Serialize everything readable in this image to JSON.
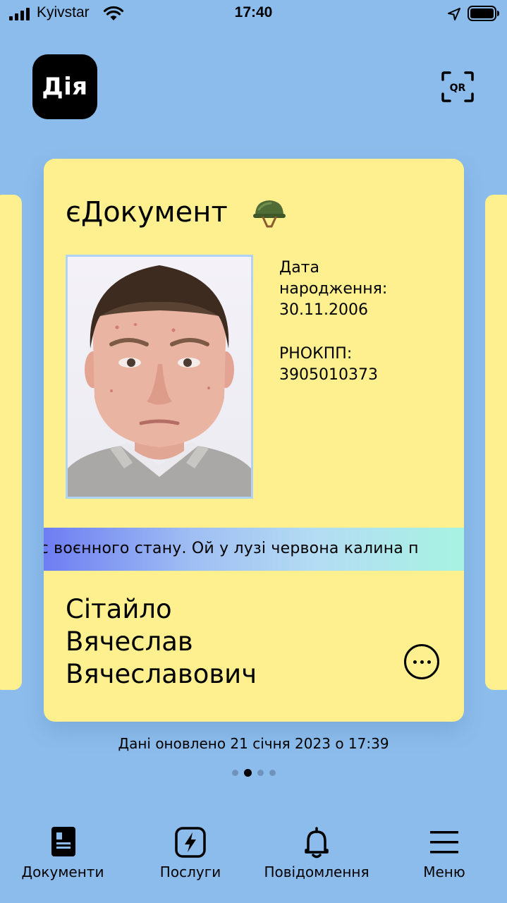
{
  "status_bar": {
    "carrier": "Kyivstar",
    "time": "17:40"
  },
  "header": {
    "logo_text": "Дія",
    "qr_label": "QR"
  },
  "card": {
    "title": "єДокумент",
    "title_icon": "military-helmet-icon",
    "birth_label_line1": "Дата",
    "birth_label_line2": "народження:",
    "birth_date": "30.11.2006",
    "tax_label": "РНОКПП:",
    "tax_number": "3905010373",
    "ticker": "ас воєнного стану. Ой у лузі червона калина п",
    "name": [
      "Сітайло",
      "Вячеслав",
      "Вячеславович"
    ]
  },
  "updated_text": "Дані оновлено 21 січня 2023 о 17:39",
  "pager": {
    "count": 4,
    "active_index": 1
  },
  "nav": {
    "documents": "Документи",
    "services": "Послуги",
    "notifications": "Повідомлення",
    "menu": "Меню"
  }
}
